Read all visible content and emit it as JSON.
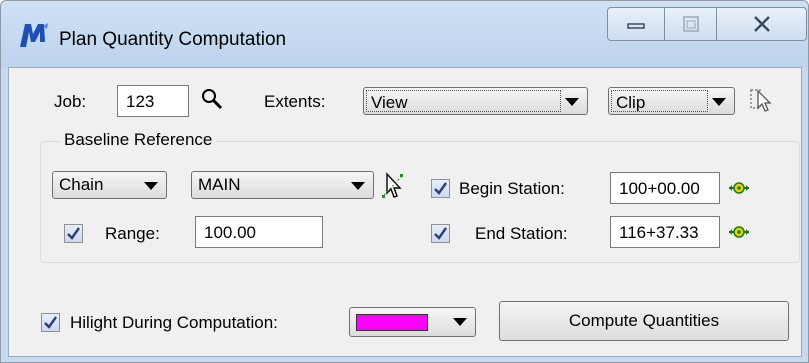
{
  "window": {
    "title": "Plan Quantity Computation"
  },
  "job": {
    "label": "Job:",
    "value": "123"
  },
  "extents": {
    "label": "Extents:",
    "selected": "View"
  },
  "clip": {
    "selected": "Clip"
  },
  "baseline": {
    "group_title": "Baseline Reference",
    "type_selected": "Chain",
    "name_selected": "MAIN",
    "range_checked": true,
    "range_label": "Range:",
    "range_value": "100.00",
    "begin_checked": true,
    "begin_label": "Begin Station:",
    "begin_value": "100+00.00",
    "end_checked": true,
    "end_label": "End Station:",
    "end_value": "116+37.33"
  },
  "hilight": {
    "checked": true,
    "label": "Hilight During Computation:",
    "color": "#ff00ff"
  },
  "compute_button": {
    "label": "Compute Quantities"
  },
  "icons": {
    "app": "microstation-logo-icon",
    "search": "magnifier-icon",
    "clip_select": "select-cursor-icon",
    "pick": "pick-element-cursor-icon",
    "begin_locate": "locate-crosshair-icon",
    "end_locate": "locate-crosshair-icon"
  }
}
